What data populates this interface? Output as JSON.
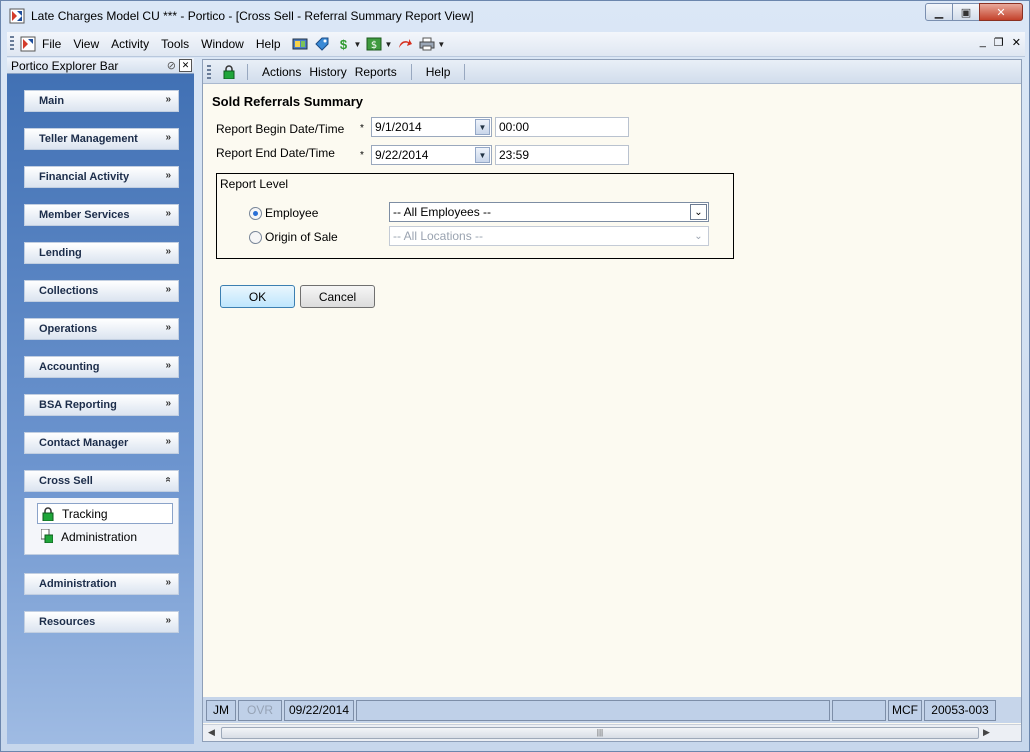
{
  "window": {
    "title": "Late Charges Model CU *** - Portico - [Cross Sell - Referral Summary Report View]",
    "minimize": "▭",
    "restore": "▣",
    "close": "✕"
  },
  "menubar": {
    "items": [
      "File",
      "View",
      "Activity",
      "Tools",
      "Window",
      "Help"
    ],
    "icons": [
      "teller-icon",
      "tag-icon",
      "dollar-icon",
      "cash-icon",
      "return-arrow-icon",
      "printer-icon"
    ],
    "mdi_min": "_",
    "mdi_restore": "❐",
    "mdi_close": "✕"
  },
  "explorer": {
    "title": "Portico Explorer Bar",
    "groups": [
      {
        "label": "Main"
      },
      {
        "label": "Teller Management"
      },
      {
        "label": "Financial Activity"
      },
      {
        "label": "Member Services"
      },
      {
        "label": "Lending"
      },
      {
        "label": "Collections"
      },
      {
        "label": "Operations"
      },
      {
        "label": "Accounting"
      },
      {
        "label": "BSA Reporting"
      },
      {
        "label": "Contact Manager"
      },
      {
        "label": "Cross Sell"
      },
      {
        "label": "Administration"
      },
      {
        "label": "Resources"
      }
    ],
    "cross_sell_items": [
      "Tracking",
      "Administration"
    ]
  },
  "content_toolbar": {
    "items": [
      "Actions",
      "History",
      "Reports",
      "Help"
    ]
  },
  "form": {
    "title": "Sold Referrals Summary",
    "begin_label": "Report Begin Date/Time",
    "end_label": "Report End Date/Time",
    "required_marker": "*",
    "begin_date": "9/1/2014",
    "begin_time": "00:00",
    "end_date": "9/22/2014",
    "end_time": "23:59",
    "report_level_label": "Report Level",
    "employee_label": "Employee",
    "origin_label": "Origin of Sale",
    "employee_value": "-- All Employees --",
    "origin_value": "-- All Locations --",
    "selected_level": "Employee",
    "ok_label": "OK",
    "cancel_label": "Cancel"
  },
  "statusbar": {
    "user": "JM",
    "ovr": "OVR",
    "date": "09/22/2014",
    "blank1": "",
    "blank2": "",
    "code": "MCF",
    "id": "20053-003"
  },
  "colors": {
    "content_bg": "#fcfaf1",
    "explorer_bg": "#3f6fb3",
    "accent": "#2a6fd6"
  }
}
